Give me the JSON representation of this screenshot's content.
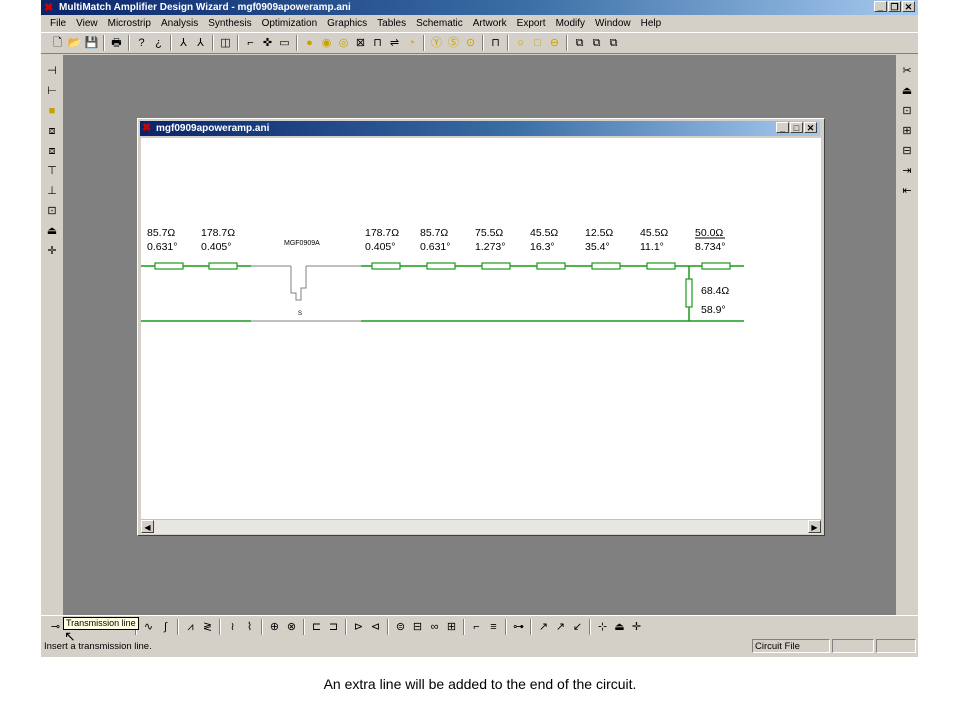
{
  "window": {
    "title": "MultiMatch Amplifier Design Wizard - mgf0909apoweramp.ani",
    "app_icon": "red-x-logo-icon"
  },
  "menu": [
    "File",
    "View",
    "Microstrip",
    "Analysis",
    "Synthesis",
    "Optimization",
    "Graphics",
    "Tables",
    "Schematic",
    "Artwork",
    "Export",
    "Modify",
    "Window",
    "Help"
  ],
  "child_window": {
    "title": "mgf0909apoweramp.ani"
  },
  "schematic": {
    "device_label": "MGF0909A",
    "source_label": "S",
    "line_color": "#1a9a1a",
    "left_elements": [
      {
        "impedance": "85.7Ω",
        "angle": "0.631°"
      },
      {
        "impedance": "178.7Ω",
        "angle": "0.405°"
      }
    ],
    "right_elements": [
      {
        "impedance": "178.7Ω",
        "angle": "0.405°"
      },
      {
        "impedance": "85.7Ω",
        "angle": "0.631°"
      },
      {
        "impedance": "75.5Ω",
        "angle": "1.273°"
      },
      {
        "impedance": "45.5Ω",
        "angle": "16.3°"
      },
      {
        "impedance": "12.5Ω",
        "angle": "35.4°"
      },
      {
        "impedance": "45.5Ω",
        "angle": "11.1°"
      },
      {
        "impedance": "50.0Ω",
        "angle": "8.734°"
      }
    ],
    "shunt_element": {
      "impedance": "68.4Ω",
      "angle": "58.9°"
    }
  },
  "tooltip": "Transmission line",
  "status": {
    "message": "Insert a transmission line.",
    "panel": "Circuit File"
  },
  "caption": "An extra line will be added to the end of the circuit."
}
